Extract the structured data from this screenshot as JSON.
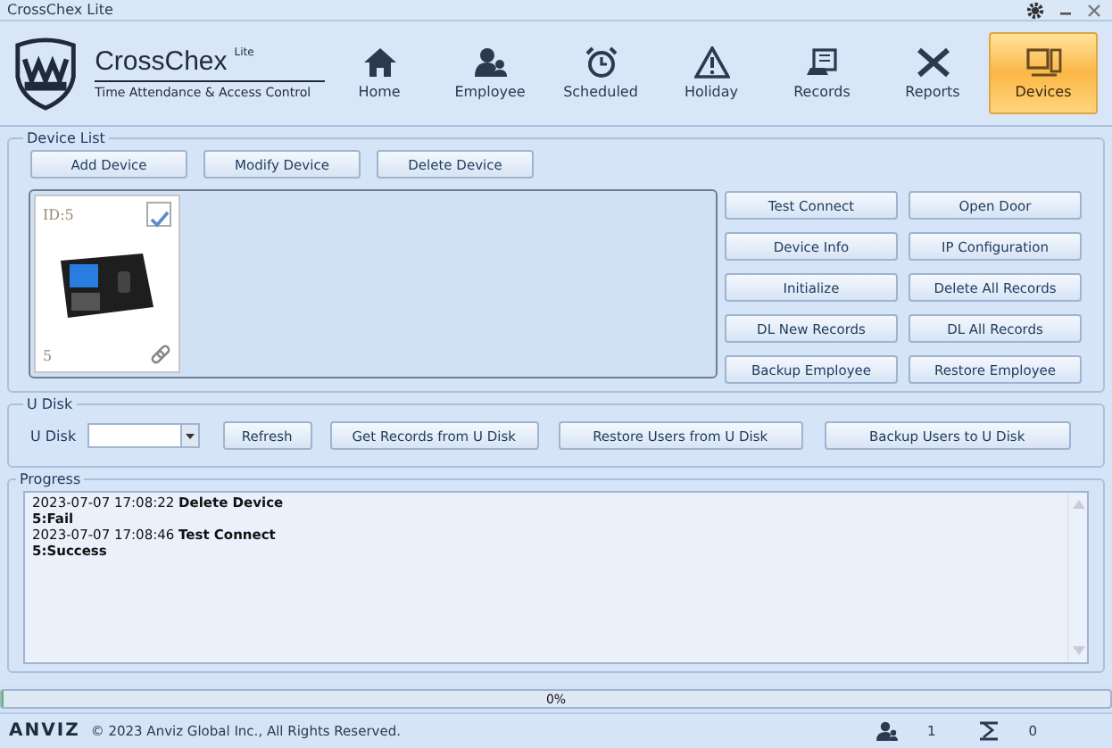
{
  "window": {
    "title": "CrossChex Lite"
  },
  "app": {
    "name": "CrossChex",
    "edition": "Lite",
    "tagline": "Time Attendance & Access Control"
  },
  "nav": [
    {
      "label": "Home",
      "kind": "home",
      "selected": false
    },
    {
      "label": "Employee",
      "kind": "employee",
      "selected": false
    },
    {
      "label": "Scheduled",
      "kind": "clock",
      "selected": false
    },
    {
      "label": "Holiday",
      "kind": "warning",
      "selected": false
    },
    {
      "label": "Records",
      "kind": "records",
      "selected": false
    },
    {
      "label": "Reports",
      "kind": "tools",
      "selected": false
    },
    {
      "label": "Devices",
      "kind": "devices",
      "selected": true
    }
  ],
  "device_list": {
    "title": "Device List",
    "buttons": [
      "Add Device",
      "Modify Device",
      "Delete Device"
    ],
    "devices": [
      {
        "id": "ID:5",
        "name": "5",
        "checked": true,
        "connected": true
      }
    ],
    "actions": [
      "Test Connect",
      "Open Door",
      "Device Info",
      "IP Configuration",
      "Initialize",
      "Delete All Records",
      "DL New Records",
      "DL All Records",
      "Backup Employee",
      "Restore Employee"
    ]
  },
  "u_disk": {
    "title": "U Disk",
    "label": "U Disk",
    "buttons": [
      "Refresh",
      "Get Records from U Disk",
      "Restore Users from U Disk",
      "Backup Users to U Disk"
    ]
  },
  "progress": {
    "title": "Progress",
    "log": [
      "2023-07-07 17:08:22 **Delete Device**",
      "**5:Fail**",
      "2023-07-07 17:08:46 **Test Connect**",
      "**5:Success**"
    ],
    "level": 0,
    "reading": "0%"
  },
  "footer": {
    "brand": "ANVIZ",
    "copyright": "© 2023 Anviz Global Inc., All Rights Reserved.",
    "users": "1",
    "devices": "0"
  }
}
